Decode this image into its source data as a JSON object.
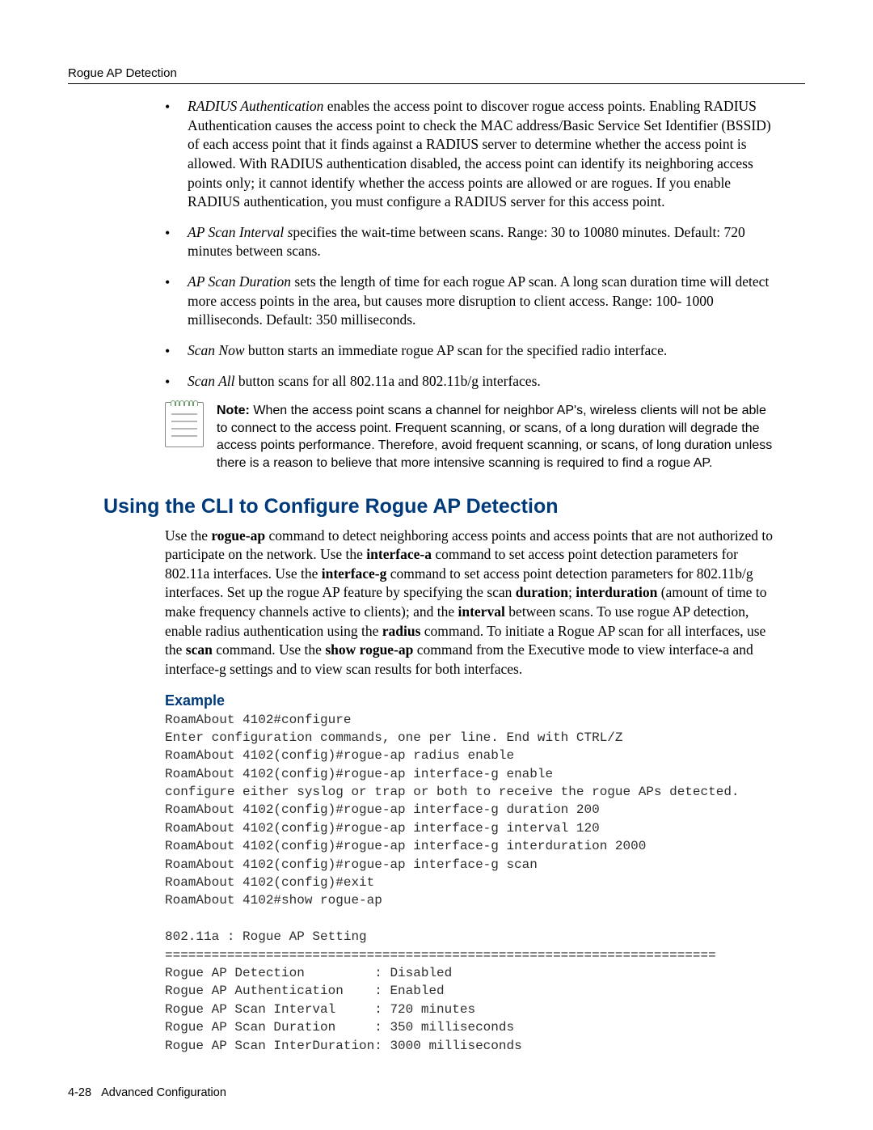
{
  "header": {
    "running": "Rogue AP Detection"
  },
  "bullets": {
    "b1_term": "RADIUS Authentication",
    "b1_rest": " enables the access point to discover rogue access points. Enabling RADIUS Authentication causes the access point to check the MAC address/Basic Service Set Identifier (BSSID) of each access point that it finds against a RADIUS server to determine whether the access point is allowed. With RADIUS authentication disabled, the access point can identify its neighboring access points only; it cannot identify whether the access points are allowed or are rogues. If you enable RADIUS authentication, you must configure a RADIUS server for this access point.",
    "b2_term": "AP Scan Interval s",
    "b2_rest": "pecifies the wait-time between scans. Range: 30 to 10080 minutes. Default: 720 minutes between scans.",
    "b3_term": "AP Scan Duration",
    "b3_rest": " sets the length of time for each rogue AP scan. A long scan duration time will detect more access points in the area, but causes more disruption to client access. Range: 100- 1000 milliseconds. Default: 350 milliseconds.",
    "b4_term": "Scan Now",
    "b4_rest": " button starts an immediate rogue AP scan for the specified radio interface.",
    "b5_term": "Scan All",
    "b5_rest": " button scans for all 802.11a and 802.11b/g interfaces."
  },
  "note": {
    "label": "Note:",
    "text": " When the access point scans a channel for neighbor AP's, wireless clients will not be able to connect to the access point. Frequent scanning, or scans, of a long duration will degrade the access points performance. Therefore, avoid frequent scanning, or scans, of long duration unless there is a reason to believe that more intensive scanning is required to find a rogue AP."
  },
  "section": {
    "title": "Using the CLI to Configure Rogue AP Detection"
  },
  "para": {
    "p_pre1": "Use the ",
    "p_b1": "rogue-ap",
    "p_mid1": " command to detect neighboring access points and access points that are not authorized to participate on the network. Use the ",
    "p_b2": "interface-a",
    "p_mid2": " command to set access point detection parameters for 802.11a interfaces. Use the ",
    "p_b3": "interface-g",
    "p_mid3": " command to set access point detection parameters for 802.11b/g interfaces. Set up the rogue AP feature by specifying the scan ",
    "p_b4": "duration",
    "p_sep1": "; ",
    "p_b5": "interduration",
    "p_mid4": " (amount of time to make frequency channels active to clients); and the ",
    "p_b6": "interval",
    "p_mid5": " between scans. To use rogue AP detection, enable radius authentication using the ",
    "p_b7": "radius",
    "p_mid6": " command. To initiate a Rogue AP scan for all interfaces, use the ",
    "p_b8": "scan",
    "p_mid7": " command. Use the ",
    "p_b9": "show rogue-ap",
    "p_mid8": " command from the Executive mode to view interface-a and interface-g settings and to view scan results for both interfaces."
  },
  "example": {
    "heading": "Example",
    "cli": "RoamAbout 4102#configure\nEnter configuration commands, one per line. End with CTRL/Z\nRoamAbout 4102(config)#rogue-ap radius enable\nRoamAbout 4102(config)#rogue-ap interface-g enable\nconfigure either syslog or trap or both to receive the rogue APs detected.\nRoamAbout 4102(config)#rogue-ap interface-g duration 200\nRoamAbout 4102(config)#rogue-ap interface-g interval 120\nRoamAbout 4102(config)#rogue-ap interface-g interduration 2000\nRoamAbout 4102(config)#rogue-ap interface-g scan\nRoamAbout 4102(config)#exit\nRoamAbout 4102#show rogue-ap\n\n802.11a : Rogue AP Setting\n=======================================================================\nRogue AP Detection         : Disabled\nRogue AP Authentication    : Enabled\nRogue AP Scan Interval     : 720 minutes\nRogue AP Scan Duration     : 350 milliseconds\nRogue AP Scan InterDuration: 3000 milliseconds"
  },
  "footer": {
    "page": "4-28",
    "label": "Advanced Configuration"
  }
}
